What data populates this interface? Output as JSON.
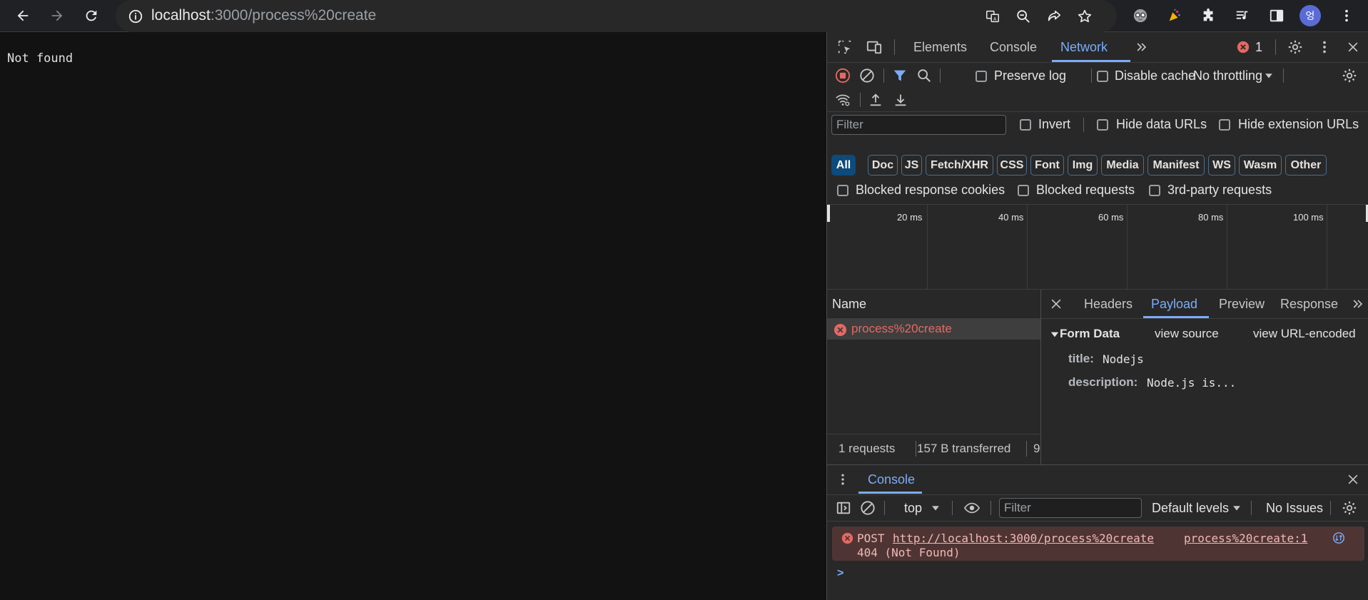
{
  "browser": {
    "url_host": "localhost",
    "url_rest": ":3000/process%20create",
    "profile_initial": "엉"
  },
  "page": {
    "text": "Not found"
  },
  "devtools": {
    "tabs": [
      "Elements",
      "Console",
      "Network"
    ],
    "active_tab": "Network",
    "error_count": "1",
    "toolbar": {
      "preserve_log": "Preserve log",
      "disable_cache": "Disable cache",
      "throttling": "No throttling"
    },
    "filter": {
      "placeholder": "Filter",
      "invert": "Invert",
      "hide_data_urls": "Hide data URLs",
      "hide_extension_urls": "Hide extension URLs"
    },
    "type_chips": [
      "All",
      "Doc",
      "JS",
      "Fetch/XHR",
      "CSS",
      "Font",
      "Img",
      "Media",
      "Manifest",
      "WS",
      "Wasm",
      "Other"
    ],
    "blocked": {
      "cookies": "Blocked response cookies",
      "requests": "Blocked requests",
      "third_party": "3rd-party requests"
    },
    "timeline_ticks": [
      "20 ms",
      "40 ms",
      "60 ms",
      "80 ms",
      "100 ms"
    ],
    "requests": {
      "header": "Name",
      "rows": [
        {
          "name": "process%20create",
          "status": "error"
        }
      ],
      "summary_count": "1 requests",
      "summary_transferred": "157 B transferred",
      "summary_cut": "9"
    },
    "detail": {
      "tabs": [
        "Headers",
        "Payload",
        "Preview",
        "Response"
      ],
      "active_tab": "Payload",
      "section_title": "Form Data",
      "view_source": "view source",
      "view_url_encoded": "view URL-encoded",
      "fields": [
        {
          "key": "title:",
          "value": "Nodejs"
        },
        {
          "key": "description:",
          "value": "Node.js is..."
        }
      ]
    },
    "drawer": {
      "tab": "Console",
      "context": "top",
      "filter_placeholder": "Filter",
      "levels": "Default levels",
      "issues": "No Issues",
      "message": {
        "method": "POST",
        "url": "http://localhost:3000/process%20create",
        "source": "process%20create:1",
        "status": "404 (Not Found)"
      },
      "prompt": ">"
    }
  },
  "colors": {
    "accent": "#7cacf8",
    "error": "#e46962",
    "error_bg": "#4e3534"
  }
}
